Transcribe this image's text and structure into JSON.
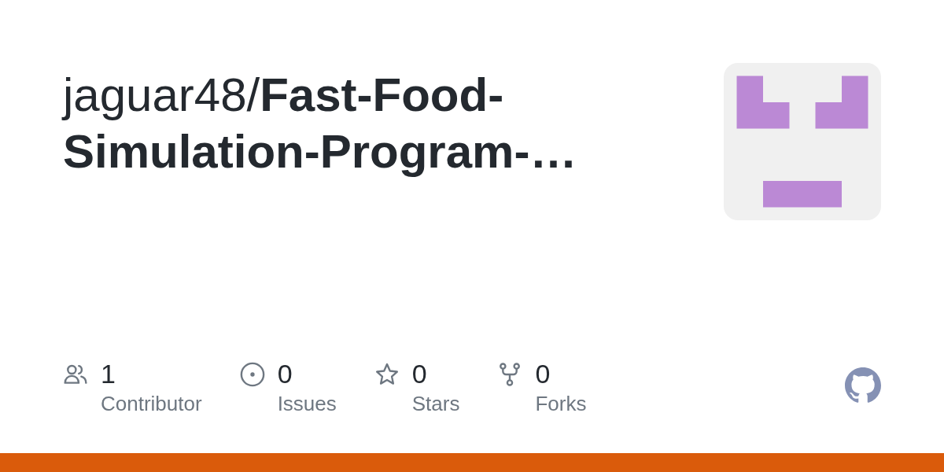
{
  "title": "jaguar48/**Fast-Food-Simulation-Program-…**",
  "stats": [
    {
      "kind": "contributors",
      "count": "1",
      "label": "Contributor"
    },
    {
      "kind": "issues",
      "count": "0",
      "label": "Issues"
    },
    {
      "kind": "stars",
      "count": "0",
      "label": "Stars"
    },
    {
      "kind": "forks",
      "count": "0",
      "label": "Forks"
    }
  ],
  "language_bar": [
    {
      "color": "#da5b0b",
      "level": 1
    }
  ]
}
